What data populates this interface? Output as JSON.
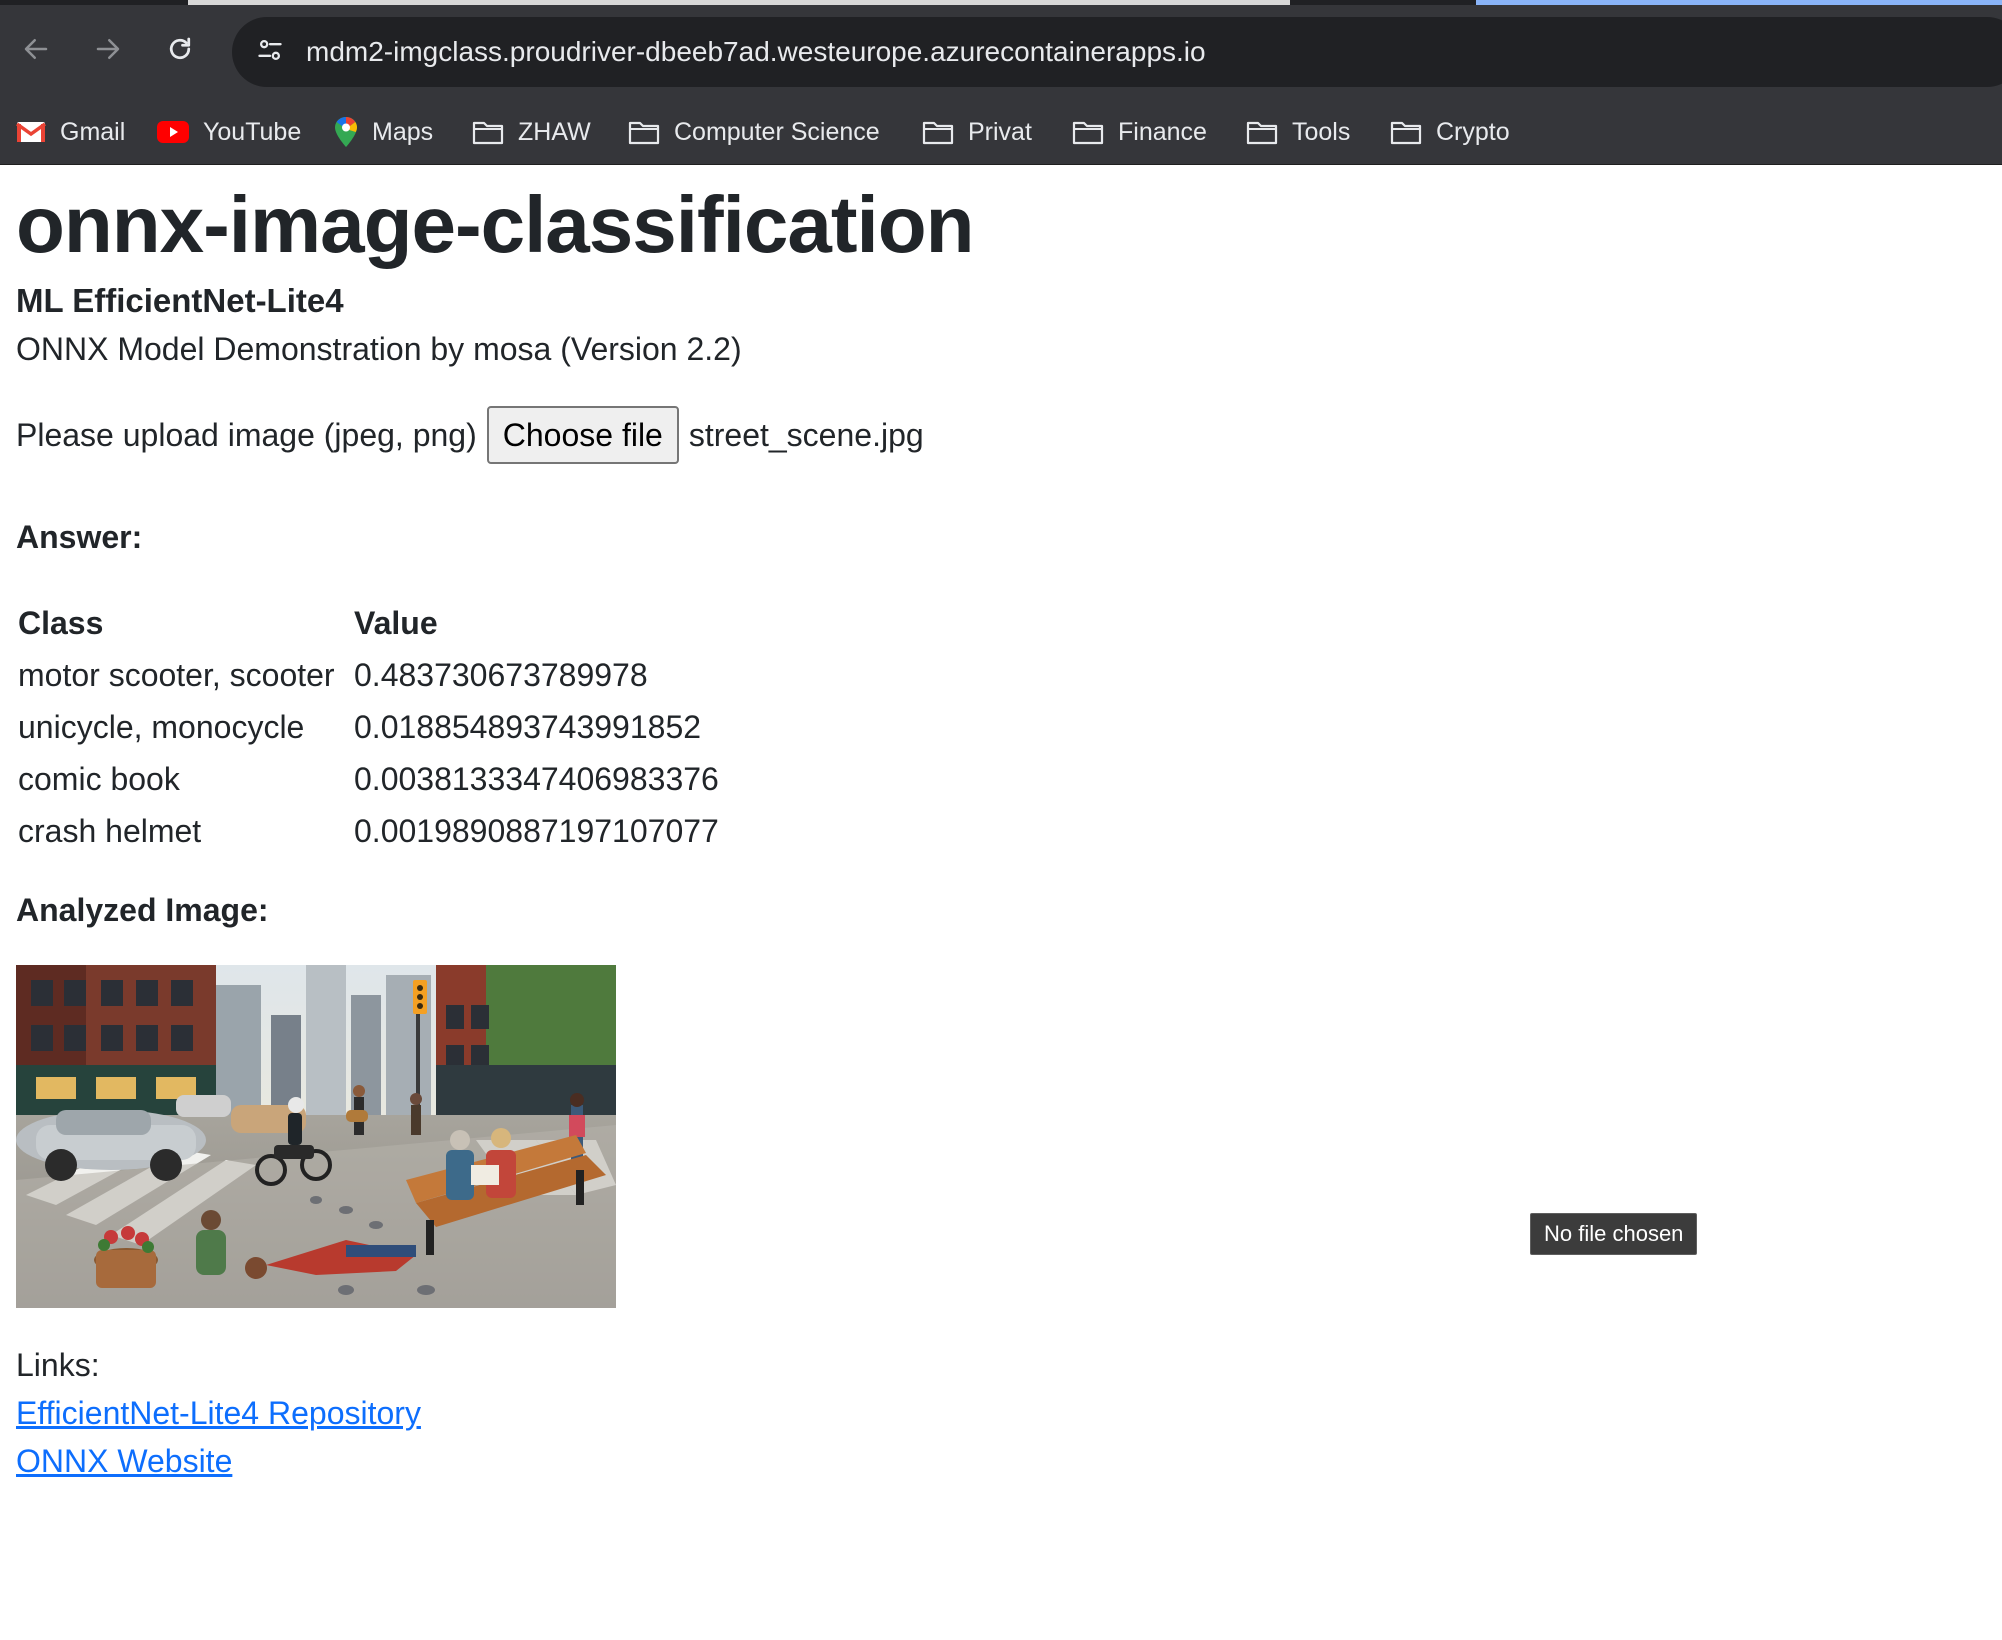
{
  "browser": {
    "url": "mdm2-imgclass.proudriver-dbeeb7ad.westeurope.azurecontainerapps.io",
    "icons": {
      "back": "back-arrow-icon",
      "forward": "forward-arrow-icon",
      "reload": "reload-icon",
      "site_info": "tune-icon"
    }
  },
  "bookmarks": [
    {
      "label": "Gmail",
      "icon": "gmail-icon"
    },
    {
      "label": "YouTube",
      "icon": "youtube-icon"
    },
    {
      "label": "Maps",
      "icon": "maps-pin-icon"
    },
    {
      "label": "ZHAW",
      "icon": "folder-icon"
    },
    {
      "label": "Computer Science",
      "icon": "folder-icon"
    },
    {
      "label": "Privat",
      "icon": "folder-icon"
    },
    {
      "label": "Finance",
      "icon": "folder-icon"
    },
    {
      "label": "Tools",
      "icon": "folder-icon"
    },
    {
      "label": "Crypto",
      "icon": "folder-icon"
    }
  ],
  "page": {
    "title": "onnx-image-classification",
    "model_name": "ML EfficientNet-Lite4",
    "description": "ONNX Model Demonstration by mosa (Version 2.2)",
    "upload": {
      "label": "Please upload image (jpeg, png)",
      "button_label": "Choose file",
      "file_name": "street_scene.jpg"
    },
    "answer_heading": "Answer:",
    "results": {
      "headers": [
        "Class",
        "Value"
      ],
      "rows": [
        [
          "motor scooter, scooter",
          "0.483730673789978"
        ],
        [
          "unicycle, monocycle",
          "0.018854893743991852"
        ],
        [
          "comic book",
          "0.0038133347406983376"
        ],
        [
          "crash helmet",
          "0.0019890887197107077"
        ]
      ]
    },
    "analyzed_heading": "Analyzed Image:",
    "links_label": "Links:",
    "links": [
      {
        "label": "EfficientNet-Lite4 Repository"
      },
      {
        "label": "ONNX Website"
      }
    ],
    "tooltip": "No file chosen"
  },
  "colors": {
    "chrome_bg": "#35363a",
    "omnibox_bg": "#202124",
    "link": "#0d6efd",
    "text": "#212529"
  }
}
